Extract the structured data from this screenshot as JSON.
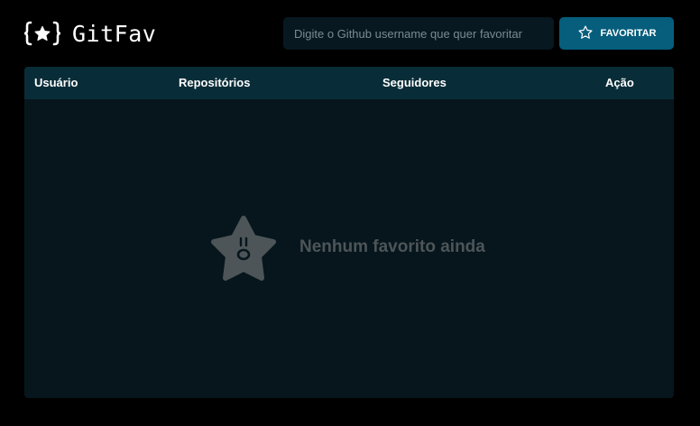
{
  "app": {
    "logo_text": "GitFav"
  },
  "search": {
    "placeholder": "Digite o Github username que quer favoritar",
    "value": ""
  },
  "favorite_button": {
    "label": "FAVORITAR",
    "icon": "star-outline-icon"
  },
  "table": {
    "columns": [
      "Usuário",
      "Repositórios",
      "Seguidores",
      "Ação"
    ],
    "rows": [],
    "empty_message": "Nenhum favorito ainda",
    "empty_icon": "sad-star-icon"
  },
  "colors": {
    "background": "#000000",
    "accent": "#065e7c",
    "table_header": "#092d38",
    "table_body": "#06161c",
    "input_background": "#071820",
    "muted_text": "#4d5558"
  }
}
